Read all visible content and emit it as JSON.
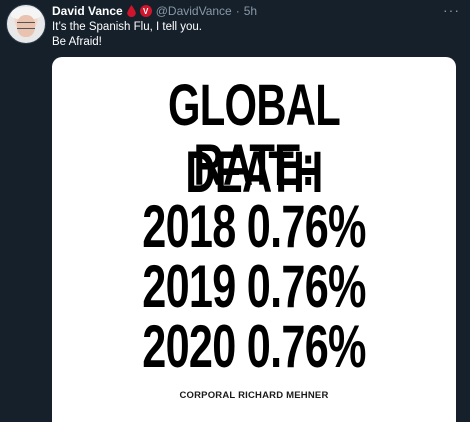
{
  "tweet": {
    "author_name": "David Vance",
    "handle": "@DavidVance",
    "separator": "·",
    "time": "5h",
    "verified_badge_letter": "V",
    "more_label": "···",
    "text_lines": [
      "It’s the Spanish Flu, I tell you.",
      "Be Afraid!"
    ]
  },
  "image": {
    "lines": [
      "GLOBAL DEATH",
      "RATE:",
      "2018 0.76%",
      "2019 0.76%",
      "2020 0.76%"
    ],
    "credit": "CORPORAL RICHARD MEHNER"
  },
  "colors": {
    "background": "#15202b",
    "secondary_text": "#8899a6",
    "badge_red": "#d0142c"
  },
  "icons": [
    "blood-drop-icon",
    "verified-v-icon",
    "more-options-icon"
  ]
}
